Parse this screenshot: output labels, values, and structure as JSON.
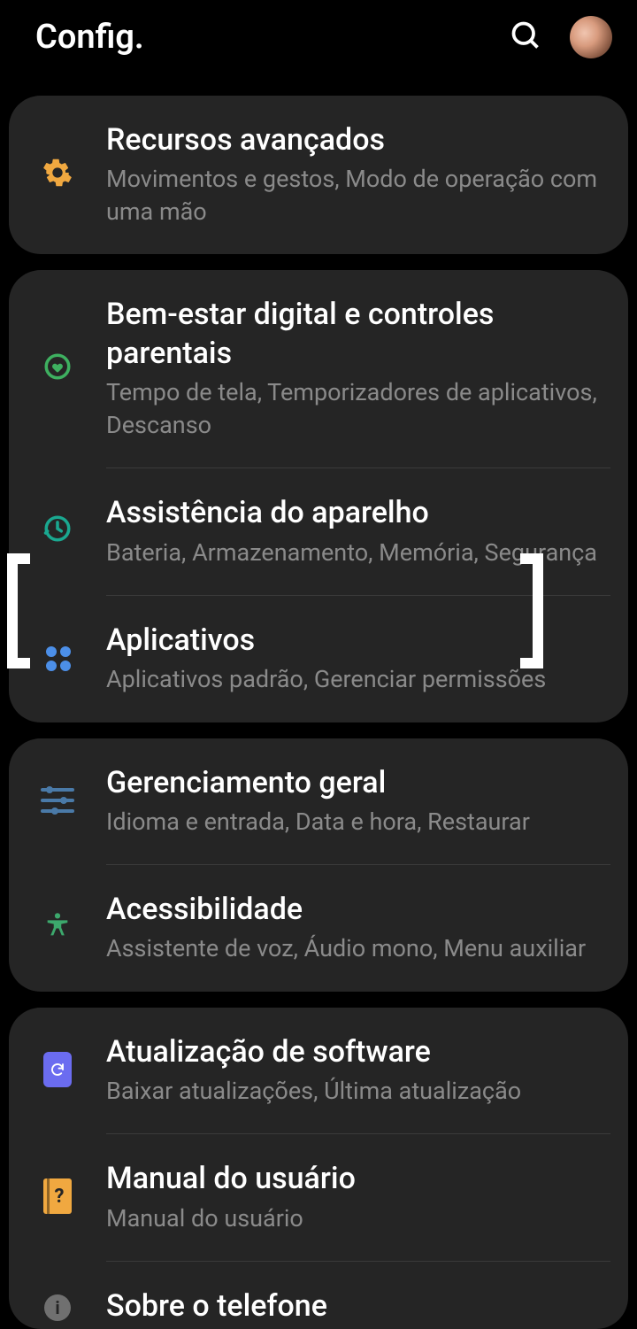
{
  "header": {
    "title": "Config."
  },
  "groups": [
    {
      "items": [
        {
          "icon": "gear",
          "title": "Recursos avançados",
          "sub": "Movimentos e gestos, Modo de operação com uma mão"
        }
      ]
    },
    {
      "items": [
        {
          "icon": "wellbeing",
          "title": "Bem-estar digital e controles parentais",
          "sub": "Tempo de tela, Temporizadores de aplicativos, Descanso"
        },
        {
          "icon": "device",
          "title": "Assistência do aparelho",
          "sub": "Bateria, Armazenamento, Memória, Segurança"
        },
        {
          "icon": "apps",
          "title": "Aplicativos",
          "sub": "Aplicativos padrão, Gerenciar permissões",
          "highlighted": true
        }
      ]
    },
    {
      "items": [
        {
          "icon": "sliders",
          "title": "Gerenciamento geral",
          "sub": "Idioma e entrada, Data e hora, Restaurar"
        },
        {
          "icon": "accessibility",
          "title": "Acessibilidade",
          "sub": "Assistente de voz, Áudio mono, Menu auxiliar"
        }
      ]
    },
    {
      "items": [
        {
          "icon": "update",
          "title": "Atualização de software",
          "sub": "Baixar atualizações, Última atualização"
        },
        {
          "icon": "manual",
          "title": "Manual do usuário",
          "sub": "Manual do usuário"
        },
        {
          "icon": "info",
          "title": "Sobre o telefone",
          "sub": ""
        }
      ]
    }
  ]
}
